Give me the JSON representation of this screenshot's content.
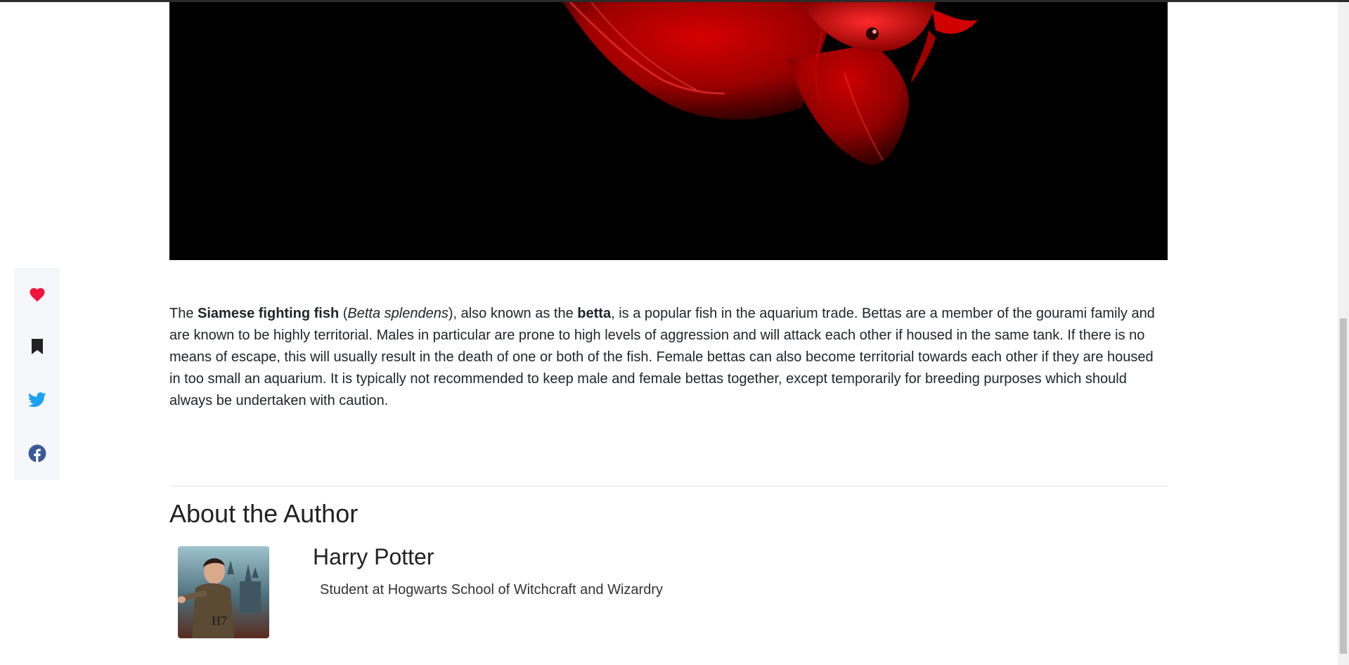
{
  "hero": {
    "image_icon": "betta-fish-image",
    "colors": {
      "background": "#000000",
      "fish": "#c40000"
    }
  },
  "share": {
    "items": [
      {
        "name": "like",
        "icon": "heart-icon",
        "color": "#f0143c"
      },
      {
        "name": "bookmark",
        "icon": "bookmark-icon",
        "color": "#222222"
      },
      {
        "name": "twitter",
        "icon": "twitter-icon",
        "color": "#1da1f2"
      },
      {
        "name": "facebook",
        "icon": "facebook-icon",
        "color": "#3b5998"
      }
    ]
  },
  "article": {
    "t1": "The ",
    "b1": "Siamese fighting fish",
    "t2": " (",
    "i1": "Betta splendens",
    "t3": "), also known as the ",
    "b2": "betta",
    "t4": ", is a popular fish in the aquarium trade. Bettas are a member of the gourami family and are known to be highly territorial. Males in particular are prone to high levels of aggression and will attack each other if housed in the same tank. If there is no means of escape, this will usually result in the death of one or both of the fish. Female bettas can also become territorial towards each other if they are housed in too small an aquarium. It is typically not recommended to keep male and female bettas together, except temporarily for breeding purposes which should always be undertaken with caution."
  },
  "about": {
    "heading": "About the Author",
    "author_name": "Harry Potter",
    "author_role": "Student at Hogwarts School of Witchcraft and Wizardry",
    "avatar_text": "H7"
  }
}
